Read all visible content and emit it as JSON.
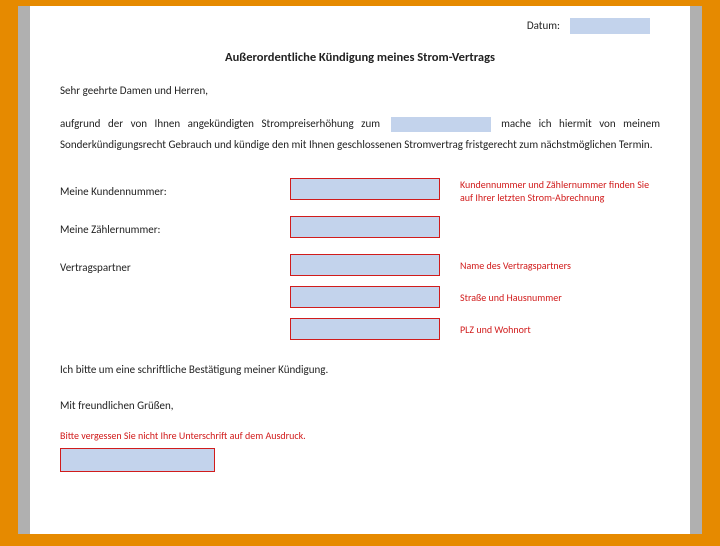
{
  "date": {
    "label": "Datum:"
  },
  "title": "Außerordentliche Kündigung meines Strom-Vertrags",
  "salutation": "Sehr geehrte Damen und Herren,",
  "para_before": "aufgrund der von Ihnen angekündigten Strompreiserhöhung zum ",
  "para_after": " mache ich hiermit von meinem Sonderkündigungsrecht Gebrauch und kündige den mit Ihnen geschlossenen Stromvertrag fristgerecht zum nächstmöglichen Termin.",
  "fields": {
    "kundennummer_label": "Meine Kundennummer:",
    "zaehlernummer_label": "Meine Zählernummer:",
    "vertragspartner_label": "Vertragspartner",
    "hint_kundennummer": "Kundennummer und Zählernummer finden Sie auf Ihrer letzten Strom-Abrechnung",
    "hint_name": "Name des Vertragspartners",
    "hint_strasse": "Straße und Hausnummer",
    "hint_plz": "PLZ und Wohnort"
  },
  "confirm": "Ich bitte um eine schriftliche Bestätigung meiner Kündigung.",
  "closing": "Mit freundlichen Grüßen,",
  "signature_hint": "Bitte vergessen Sie nicht Ihre Unterschrift auf dem Ausdruck."
}
